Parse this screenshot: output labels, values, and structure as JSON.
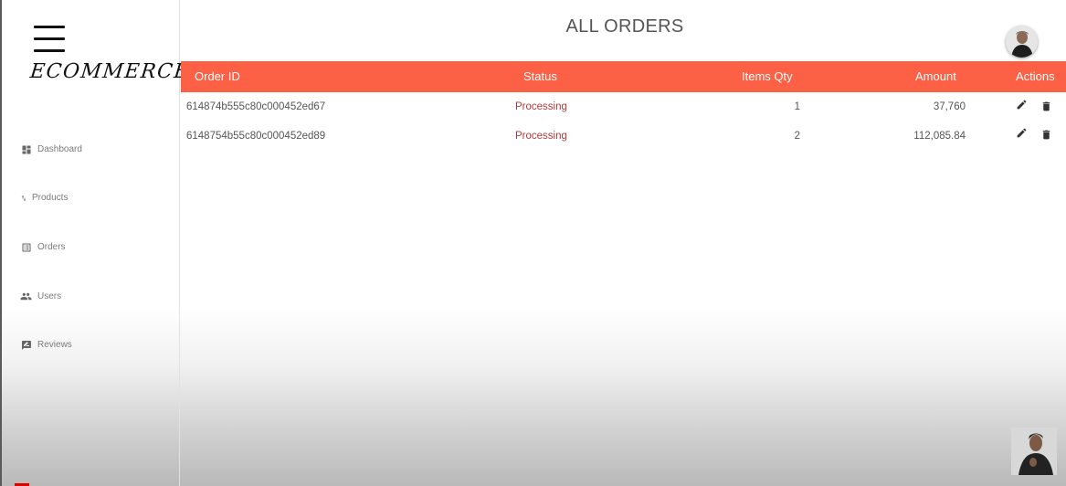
{
  "app": {
    "brand": "ECOMMERCE.",
    "page_title": "ALL ORDERS"
  },
  "sidebar": {
    "items": [
      {
        "label": "Dashboard",
        "icon": "dashboard-icon"
      },
      {
        "label": "Products",
        "icon": "import-export-icon"
      },
      {
        "label": "Orders",
        "icon": "list-alt-icon"
      },
      {
        "label": "Users",
        "icon": "people-icon"
      },
      {
        "label": "Reviews",
        "icon": "rate-review-icon"
      }
    ]
  },
  "table": {
    "columns": [
      "Order ID",
      "Status",
      "Items Qty",
      "Amount",
      "Actions"
    ],
    "rows": [
      {
        "order_id": "614874b555c80c000452ed67",
        "status": "Processing",
        "qty": "1",
        "amount": "37,760"
      },
      {
        "order_id": "6148754b55c80c000452ed89",
        "status": "Processing",
        "qty": "2",
        "amount": "112,085.84"
      }
    ],
    "actions": [
      "edit-icon",
      "delete-icon"
    ]
  },
  "colors": {
    "header_bg": "#fd6145",
    "status_processing": "#b33a3a",
    "sidebar_text": "#7a7a7a"
  }
}
